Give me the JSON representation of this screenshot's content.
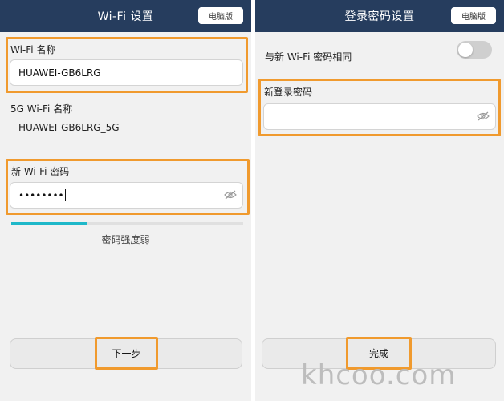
{
  "left": {
    "title": "Wi-Fi 设置",
    "pc_button": "电脑版",
    "wifi_name_label": "Wi-Fi 名称",
    "wifi_name_value": "HUAWEI-GB6LRG",
    "wifi5g_label": "5G Wi-Fi 名称",
    "wifi5g_value": "HUAWEI-GB6LRG_5G",
    "new_password_label": "新 Wi-Fi 密码",
    "new_password_value": "••••••••",
    "strength_text": "密码强度弱",
    "strength_level": 0.33,
    "next_button": "下一步"
  },
  "right": {
    "title": "登录密码设置",
    "pc_button": "电脑版",
    "same_as_wifi_label": "与新 Wi-Fi 密码相同",
    "same_as_wifi_on": false,
    "new_login_password_label": "新登录密码",
    "new_login_password_value": "",
    "finish_button": "完成"
  },
  "watermark": "khcoo.com",
  "colors": {
    "header": "#263d5e",
    "highlight": "#f09a2e",
    "strength": "#1fb8c9",
    "background": "#f1f1f1"
  }
}
